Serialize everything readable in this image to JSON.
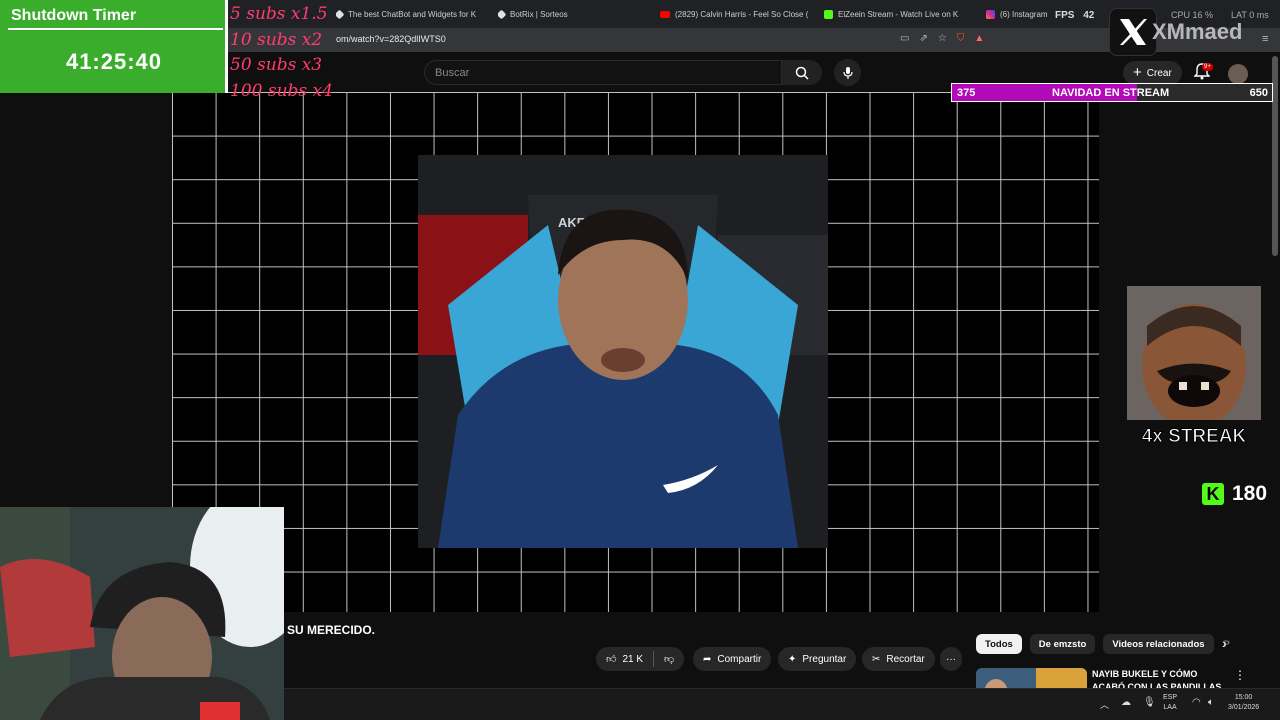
{
  "browser": {
    "tabs": [
      {
        "label": "The best ChatBot and Widgets for K",
        "color": "#e0e0e0"
      },
      {
        "label": "BotRix | Sorteos",
        "color": "#e0e0e0"
      },
      {
        "label": "(2829) Calvin Harris - Feel So Close (",
        "color": "#ff0000"
      },
      {
        "label": "ElZeein Stream - Watch Live on K",
        "color": "#53fc18"
      },
      {
        "label": "(6) Instagram",
        "color": "#d6249f"
      }
    ],
    "url": "om/watch?v=282QdlIWTS0",
    "fps_label": "FPS",
    "fps_value": "42",
    "cpu_label": "CPU",
    "cpu_value": "16 %",
    "lat_label": "LAT",
    "lat_value": "0 ms"
  },
  "youtube": {
    "search_placeholder": "Buscar",
    "create_label": "Crear",
    "notif_count": "9+",
    "video_title": "SU MERECIDO.",
    "actions": {
      "likes": "21 K",
      "share": "Compartir",
      "ask": "Preguntar",
      "clip": "Recortar",
      "more": "···"
    },
    "chips": [
      "Todos",
      "De emzsto",
      "Videos relacionados",
      "P"
    ],
    "recommendation_title": "NAYIB BUKELE Y CÓMO ACABÓ CON LAS PANDILLAS EN EL"
  },
  "overlay": {
    "timer_title": "Shutdown Timer",
    "timer_value": "41:25:40",
    "subs": [
      "5 subs x1.5",
      "10 subs x2",
      "50 subs x3",
      "100 subs x4"
    ],
    "x_handle": "XMmaed",
    "goal_left": "375",
    "goal_title": "NAVIDAD EN STREAM",
    "goal_right": "650",
    "goal_progress": 0.577,
    "streak": "4x STREAK",
    "kick_logo": "K",
    "kick_count": "180"
  },
  "taskbar": {
    "lang": "ESP",
    "layout": "LAA",
    "time": "15:00",
    "date": "3/01/2026"
  },
  "colors": {
    "timer_bg": "#3aae2c",
    "subs_text": "#ff3d6e",
    "goal_fill": "#b10bb9",
    "kick": "#53fc18"
  }
}
